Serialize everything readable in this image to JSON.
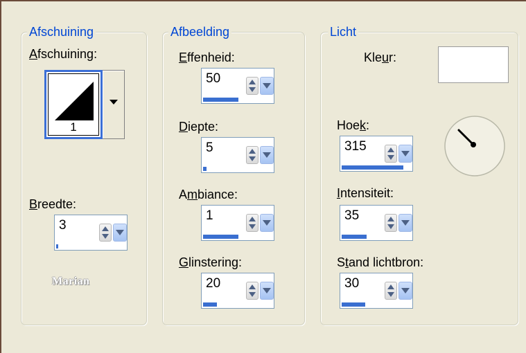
{
  "groups": {
    "bevel": {
      "title": "Afschuining",
      "bevel_label": "fschuining:",
      "bevel_mnemonic": "A",
      "bevel_value": "1",
      "width_label": "reedte:",
      "width_mnemonic": "B",
      "width_value": "3",
      "width_fill": 0.03
    },
    "image": {
      "title": "Afbeelding",
      "smoothness_mnemonic": "E",
      "smoothness_label": "ffenheid:",
      "smoothness_value": "50",
      "smoothness_fill": 0.5,
      "depth_mnemonic": "D",
      "depth_label": "iepte:",
      "depth_value": "5",
      "depth_fill": 0.05,
      "ambience_pre": "A",
      "ambience_mnemonic": "m",
      "ambience_label": "biance:",
      "ambience_value": "1",
      "ambience_fill": 0.5,
      "shininess_mnemonic": "G",
      "shininess_label": "linstering:",
      "shininess_value": "20",
      "shininess_fill": 0.2
    },
    "light": {
      "title": "Licht",
      "color_label_pre": "Kle",
      "color_mnemonic": "u",
      "color_label_post": "r:",
      "color_value": "#ffffff",
      "angle_pre": "Hoe",
      "angle_mnemonic": "k",
      "angle_post": ":",
      "angle_value": "315",
      "angle_fill": 0.875,
      "intensity_mnemonic": "I",
      "intensity_label": "ntensiteit:",
      "intensity_value": "35",
      "intensity_fill": 0.35,
      "elevation_pre": "S",
      "elevation_mnemonic": "t",
      "elevation_label": "and lichtbron:",
      "elevation_value": "30",
      "elevation_fill": 0.33
    }
  },
  "signature": "Marian",
  "colors": {
    "accent": "#0046d5",
    "bar": "#3a6fd0",
    "background": "#ece9d8"
  },
  "icons": [
    "bevel-triangle-icon",
    "spin-updown-icon",
    "dropdown-arrow-icon",
    "light-direction-dial-icon"
  ]
}
